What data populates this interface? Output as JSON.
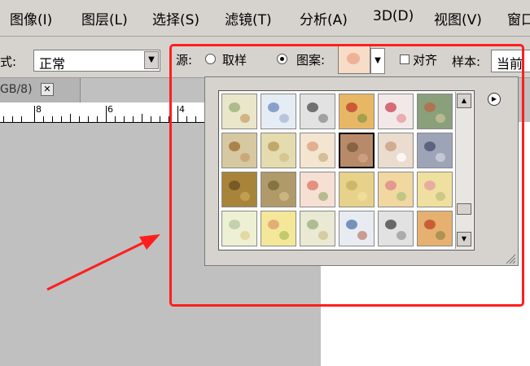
{
  "menubar": {
    "items": [
      "图像(I)",
      "图层(L)",
      "选择(S)",
      "滤镜(T)",
      "分析(A)",
      "3D(D)",
      "视图(V)",
      "窗口"
    ]
  },
  "options": {
    "mode_label": "式:",
    "mode_value": "正常",
    "source_label": "源:",
    "source_sample": "取样",
    "source_pattern": "图案:",
    "align_label": "对齐",
    "sample_label": "样本:",
    "sample_value": "当前"
  },
  "document": {
    "tab_title": "GB/8)",
    "ruler_labels": [
      "8",
      "6",
      "4"
    ]
  },
  "picker": {
    "selected_index": 9,
    "patterns": [
      {
        "bg": "#e9e6c9",
        "a": "#9db07a",
        "b": "#c9a06a"
      },
      {
        "bg": "#e6ecf3",
        "a": "#6f8fbf",
        "b": "#a8b7d6"
      },
      {
        "bg": "#e2e2e2",
        "a": "#555555",
        "b": "#8a8a8a"
      },
      {
        "bg": "#e8b765",
        "a": "#c0432a",
        "b": "#8a9a4a"
      },
      {
        "bg": "#f3e8e8",
        "a": "#d14a5a",
        "b": "#e79aa0"
      },
      {
        "bg": "#8aa07a",
        "a": "#b86a4a",
        "b": "#c9c29a"
      },
      {
        "bg": "#d6c8a0",
        "a": "#a0703a",
        "b": "#c4a06a"
      },
      {
        "bg": "#e4dcae",
        "a": "#b89a5a",
        "b": "#d0bf8a"
      },
      {
        "bg": "#f3e5d0",
        "a": "#e0a080",
        "b": "#c9b08a"
      },
      {
        "bg": "#b88a6a",
        "a": "#7a5a3a",
        "b": "#d2a68a"
      },
      {
        "bg": "#eadccf",
        "a": "#c9a080",
        "b": "#ffffff"
      },
      {
        "bg": "#9ea4b8",
        "a": "#4a5270",
        "b": "#d0d4e0"
      },
      {
        "bg": "#a8843a",
        "a": "#6a5020",
        "b": "#c9a85a"
      },
      {
        "bg": "#b09a6a",
        "a": "#7a6a3a",
        "b": "#d0bf8a"
      },
      {
        "bg": "#f6e0d4",
        "a": "#e07a6a",
        "b": "#a0b07a"
      },
      {
        "bg": "#e6d28a",
        "a": "#c9b060",
        "b": "#f0e0a0"
      },
      {
        "bg": "#f0d8a0",
        "a": "#e08a8a",
        "b": "#b0c07a"
      },
      {
        "bg": "#f0e0a0",
        "a": "#e6a0a0",
        "b": "#c0c080"
      },
      {
        "bg": "#eef0d4",
        "a": "#b9c9a0",
        "b": "#e0d090"
      },
      {
        "bg": "#f5e79a",
        "a": "#e0a070",
        "b": "#b0c060"
      },
      {
        "bg": "#e9e9d4",
        "a": "#a0b080",
        "b": "#d0c090"
      },
      {
        "bg": "#e8ecf2",
        "a": "#5a7ab0",
        "b": "#c08070"
      },
      {
        "bg": "#e2e2e2",
        "a": "#4a4a4a",
        "b": "#9a9a9a"
      },
      {
        "bg": "#e6b070",
        "a": "#c04a2a",
        "b": "#9a8a4a"
      }
    ]
  },
  "colors": {
    "annotation": "#ff1e1e",
    "panel": "#d6d3ce",
    "workspace": "#c0c0c0"
  }
}
